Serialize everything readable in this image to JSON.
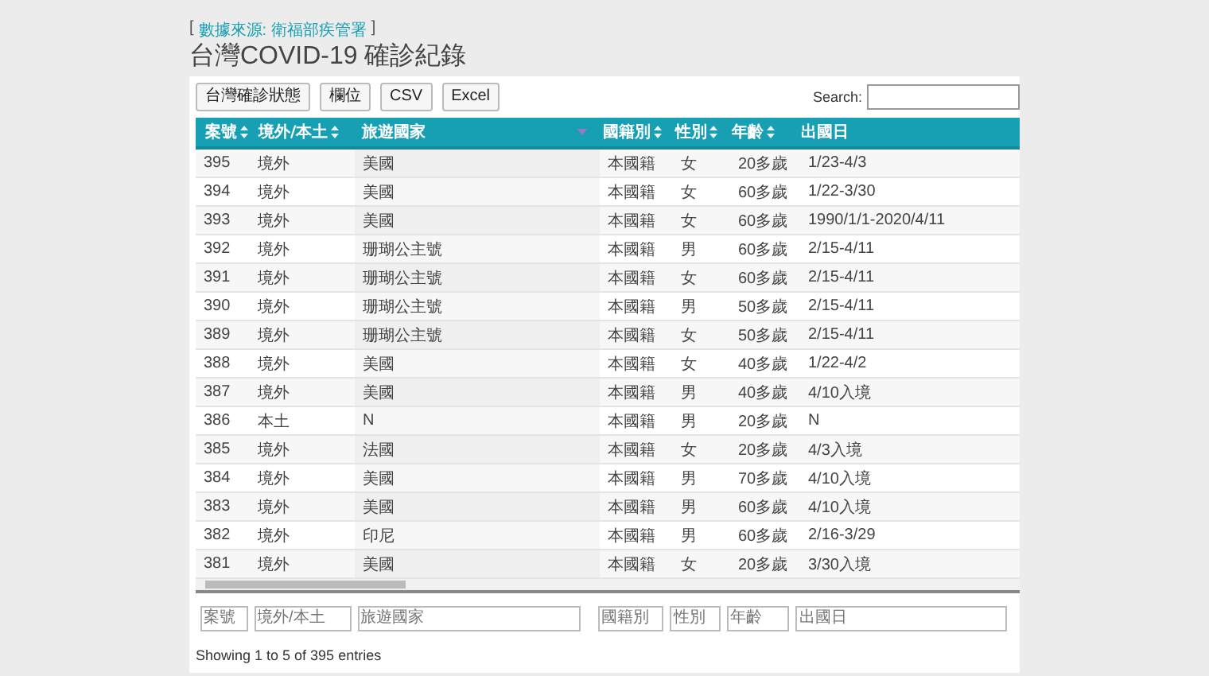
{
  "source": {
    "open": "[",
    "link": "數據來源: 衛福部疾管署",
    "close": "]"
  },
  "title": "台灣COVID-19 確診紀錄",
  "buttons": [
    "台灣確診狀態",
    "欄位",
    "CSV",
    "Excel"
  ],
  "search": {
    "label": "Search:"
  },
  "table": {
    "columns": [
      {
        "label": "案號",
        "sortable": true,
        "sorted": false
      },
      {
        "label": "境外/本土",
        "sortable": true,
        "sorted": false
      },
      {
        "label": "旅遊國家",
        "sortable": true,
        "sorted": true
      },
      {
        "label": "國籍別",
        "sortable": true,
        "sorted": false
      },
      {
        "label": "性別",
        "sortable": true,
        "sorted": false
      },
      {
        "label": "年齡",
        "sortable": true,
        "sorted": false
      },
      {
        "label": "出國日",
        "sortable": false,
        "sorted": false
      }
    ],
    "rows": [
      [
        "395",
        "境外",
        "美國",
        "本國籍",
        "女",
        "20多歲",
        "1/23-4/3"
      ],
      [
        "394",
        "境外",
        "美國",
        "本國籍",
        "女",
        "60多歲",
        "1/22-3/30"
      ],
      [
        "393",
        "境外",
        "美國",
        "本國籍",
        "女",
        "60多歲",
        "1990/1/1-2020/4/11"
      ],
      [
        "392",
        "境外",
        "珊瑚公主號",
        "本國籍",
        "男",
        "60多歲",
        "2/15-4/11"
      ],
      [
        "391",
        "境外",
        "珊瑚公主號",
        "本國籍",
        "女",
        "60多歲",
        "2/15-4/11"
      ],
      [
        "390",
        "境外",
        "珊瑚公主號",
        "本國籍",
        "男",
        "50多歲",
        "2/15-4/11"
      ],
      [
        "389",
        "境外",
        "珊瑚公主號",
        "本國籍",
        "女",
        "50多歲",
        "2/15-4/11"
      ],
      [
        "388",
        "境外",
        "美國",
        "本國籍",
        "女",
        "40多歲",
        "1/22-4/2"
      ],
      [
        "387",
        "境外",
        "美國",
        "本國籍",
        "男",
        "40多歲",
        "4/10入境"
      ],
      [
        "386",
        "本土",
        "N",
        "本國籍",
        "男",
        "20多歲",
        "N"
      ],
      [
        "385",
        "境外",
        "法國",
        "本國籍",
        "女",
        "20多歲",
        "4/3入境"
      ],
      [
        "384",
        "境外",
        "美國",
        "本國籍",
        "男",
        "70多歲",
        "4/10入境"
      ],
      [
        "383",
        "境外",
        "美國",
        "本國籍",
        "男",
        "60多歲",
        "4/10入境"
      ],
      [
        "382",
        "境外",
        "印尼",
        "本國籍",
        "男",
        "60多歲",
        "2/16-3/29"
      ],
      [
        "381",
        "境外",
        "美國",
        "本國籍",
        "女",
        "20多歲",
        "3/30入境"
      ]
    ],
    "filters": [
      {
        "placeholder": "案號"
      },
      {
        "placeholder": "境外/本土"
      },
      {
        "placeholder": "旅遊國家"
      },
      {
        "placeholder": "國籍別"
      },
      {
        "placeholder": "性別"
      },
      {
        "placeholder": "年齡"
      },
      {
        "placeholder": "出國日"
      }
    ]
  },
  "info": "Showing 1 to 5 of 395 entries"
}
